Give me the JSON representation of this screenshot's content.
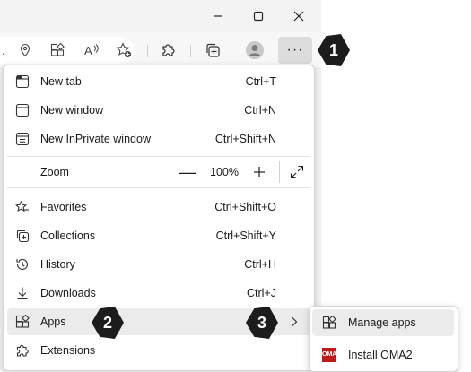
{
  "window": {
    "controls": [
      "minimize-icon",
      "maximize-icon",
      "close-icon"
    ]
  },
  "toolbar": {
    "address_snippet": ".",
    "icons": [
      "location-icon",
      "apps-icon",
      "read-aloud-icon",
      "add-favorite-icon",
      "extensions-icon",
      "collections-icon",
      "profile-icon"
    ],
    "more_label": "···"
  },
  "menu": {
    "items": [
      {
        "label": "New tab",
        "shortcut": "Ctrl+T",
        "icon": "new-tab-icon"
      },
      {
        "label": "New window",
        "shortcut": "Ctrl+N",
        "icon": "new-window-icon"
      },
      {
        "label": "New InPrivate window",
        "shortcut": "Ctrl+Shift+N",
        "icon": "inprivate-icon"
      },
      {
        "label": "Zoom",
        "icon": ""
      },
      {
        "label": "Favorites",
        "shortcut": "Ctrl+Shift+O",
        "icon": "favorites-icon"
      },
      {
        "label": "Collections",
        "shortcut": "Ctrl+Shift+Y",
        "icon": "collections-icon"
      },
      {
        "label": "History",
        "shortcut": "Ctrl+H",
        "icon": "history-icon"
      },
      {
        "label": "Downloads",
        "shortcut": "Ctrl+J",
        "icon": "downloads-icon"
      },
      {
        "label": "Apps",
        "shortcut": "",
        "icon": "apps-icon"
      },
      {
        "label": "Extensions",
        "shortcut": "",
        "icon": "extensions-icon"
      }
    ],
    "zoom": {
      "minus": "—",
      "value": "100%",
      "plus": "+"
    }
  },
  "submenu": {
    "items": [
      {
        "label": "Manage apps",
        "icon": "apps-icon"
      },
      {
        "label": "Install OMA2",
        "icon": "oma-app-icon",
        "logo_text": "OMA2"
      }
    ]
  },
  "callouts": [
    "1",
    "2",
    "3"
  ]
}
